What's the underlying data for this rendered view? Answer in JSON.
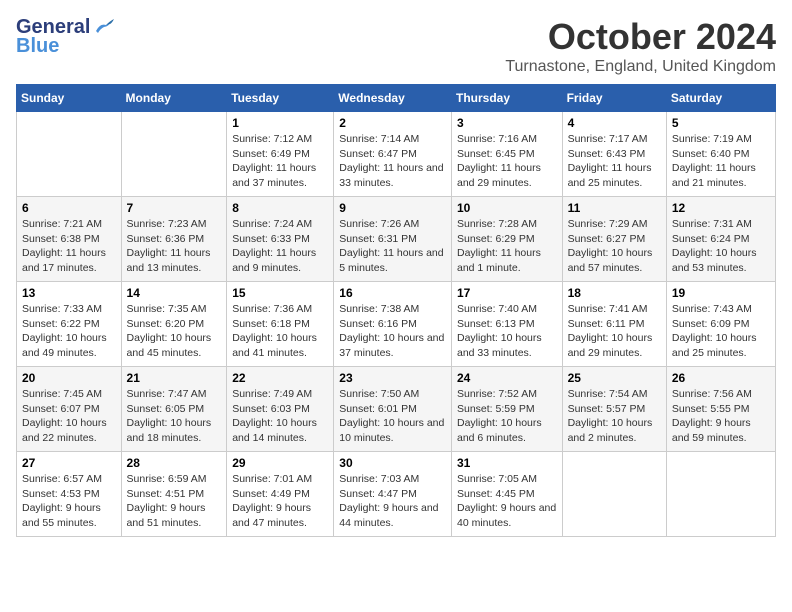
{
  "header": {
    "logo_line1": "General",
    "logo_line2": "Blue",
    "month_title": "October 2024",
    "subtitle": "Turnastone, England, United Kingdom"
  },
  "weekdays": [
    "Sunday",
    "Monday",
    "Tuesday",
    "Wednesday",
    "Thursday",
    "Friday",
    "Saturday"
  ],
  "weeks": [
    [
      {
        "day": "",
        "sunrise": "",
        "sunset": "",
        "daylight": ""
      },
      {
        "day": "",
        "sunrise": "",
        "sunset": "",
        "daylight": ""
      },
      {
        "day": "1",
        "sunrise": "Sunrise: 7:12 AM",
        "sunset": "Sunset: 6:49 PM",
        "daylight": "Daylight: 11 hours and 37 minutes."
      },
      {
        "day": "2",
        "sunrise": "Sunrise: 7:14 AM",
        "sunset": "Sunset: 6:47 PM",
        "daylight": "Daylight: 11 hours and 33 minutes."
      },
      {
        "day": "3",
        "sunrise": "Sunrise: 7:16 AM",
        "sunset": "Sunset: 6:45 PM",
        "daylight": "Daylight: 11 hours and 29 minutes."
      },
      {
        "day": "4",
        "sunrise": "Sunrise: 7:17 AM",
        "sunset": "Sunset: 6:43 PM",
        "daylight": "Daylight: 11 hours and 25 minutes."
      },
      {
        "day": "5",
        "sunrise": "Sunrise: 7:19 AM",
        "sunset": "Sunset: 6:40 PM",
        "daylight": "Daylight: 11 hours and 21 minutes."
      }
    ],
    [
      {
        "day": "6",
        "sunrise": "Sunrise: 7:21 AM",
        "sunset": "Sunset: 6:38 PM",
        "daylight": "Daylight: 11 hours and 17 minutes."
      },
      {
        "day": "7",
        "sunrise": "Sunrise: 7:23 AM",
        "sunset": "Sunset: 6:36 PM",
        "daylight": "Daylight: 11 hours and 13 minutes."
      },
      {
        "day": "8",
        "sunrise": "Sunrise: 7:24 AM",
        "sunset": "Sunset: 6:33 PM",
        "daylight": "Daylight: 11 hours and 9 minutes."
      },
      {
        "day": "9",
        "sunrise": "Sunrise: 7:26 AM",
        "sunset": "Sunset: 6:31 PM",
        "daylight": "Daylight: 11 hours and 5 minutes."
      },
      {
        "day": "10",
        "sunrise": "Sunrise: 7:28 AM",
        "sunset": "Sunset: 6:29 PM",
        "daylight": "Daylight: 11 hours and 1 minute."
      },
      {
        "day": "11",
        "sunrise": "Sunrise: 7:29 AM",
        "sunset": "Sunset: 6:27 PM",
        "daylight": "Daylight: 10 hours and 57 minutes."
      },
      {
        "day": "12",
        "sunrise": "Sunrise: 7:31 AM",
        "sunset": "Sunset: 6:24 PM",
        "daylight": "Daylight: 10 hours and 53 minutes."
      }
    ],
    [
      {
        "day": "13",
        "sunrise": "Sunrise: 7:33 AM",
        "sunset": "Sunset: 6:22 PM",
        "daylight": "Daylight: 10 hours and 49 minutes."
      },
      {
        "day": "14",
        "sunrise": "Sunrise: 7:35 AM",
        "sunset": "Sunset: 6:20 PM",
        "daylight": "Daylight: 10 hours and 45 minutes."
      },
      {
        "day": "15",
        "sunrise": "Sunrise: 7:36 AM",
        "sunset": "Sunset: 6:18 PM",
        "daylight": "Daylight: 10 hours and 41 minutes."
      },
      {
        "day": "16",
        "sunrise": "Sunrise: 7:38 AM",
        "sunset": "Sunset: 6:16 PM",
        "daylight": "Daylight: 10 hours and 37 minutes."
      },
      {
        "day": "17",
        "sunrise": "Sunrise: 7:40 AM",
        "sunset": "Sunset: 6:13 PM",
        "daylight": "Daylight: 10 hours and 33 minutes."
      },
      {
        "day": "18",
        "sunrise": "Sunrise: 7:41 AM",
        "sunset": "Sunset: 6:11 PM",
        "daylight": "Daylight: 10 hours and 29 minutes."
      },
      {
        "day": "19",
        "sunrise": "Sunrise: 7:43 AM",
        "sunset": "Sunset: 6:09 PM",
        "daylight": "Daylight: 10 hours and 25 minutes."
      }
    ],
    [
      {
        "day": "20",
        "sunrise": "Sunrise: 7:45 AM",
        "sunset": "Sunset: 6:07 PM",
        "daylight": "Daylight: 10 hours and 22 minutes."
      },
      {
        "day": "21",
        "sunrise": "Sunrise: 7:47 AM",
        "sunset": "Sunset: 6:05 PM",
        "daylight": "Daylight: 10 hours and 18 minutes."
      },
      {
        "day": "22",
        "sunrise": "Sunrise: 7:49 AM",
        "sunset": "Sunset: 6:03 PM",
        "daylight": "Daylight: 10 hours and 14 minutes."
      },
      {
        "day": "23",
        "sunrise": "Sunrise: 7:50 AM",
        "sunset": "Sunset: 6:01 PM",
        "daylight": "Daylight: 10 hours and 10 minutes."
      },
      {
        "day": "24",
        "sunrise": "Sunrise: 7:52 AM",
        "sunset": "Sunset: 5:59 PM",
        "daylight": "Daylight: 10 hours and 6 minutes."
      },
      {
        "day": "25",
        "sunrise": "Sunrise: 7:54 AM",
        "sunset": "Sunset: 5:57 PM",
        "daylight": "Daylight: 10 hours and 2 minutes."
      },
      {
        "day": "26",
        "sunrise": "Sunrise: 7:56 AM",
        "sunset": "Sunset: 5:55 PM",
        "daylight": "Daylight: 9 hours and 59 minutes."
      }
    ],
    [
      {
        "day": "27",
        "sunrise": "Sunrise: 6:57 AM",
        "sunset": "Sunset: 4:53 PM",
        "daylight": "Daylight: 9 hours and 55 minutes."
      },
      {
        "day": "28",
        "sunrise": "Sunrise: 6:59 AM",
        "sunset": "Sunset: 4:51 PM",
        "daylight": "Daylight: 9 hours and 51 minutes."
      },
      {
        "day": "29",
        "sunrise": "Sunrise: 7:01 AM",
        "sunset": "Sunset: 4:49 PM",
        "daylight": "Daylight: 9 hours and 47 minutes."
      },
      {
        "day": "30",
        "sunrise": "Sunrise: 7:03 AM",
        "sunset": "Sunset: 4:47 PM",
        "daylight": "Daylight: 9 hours and 44 minutes."
      },
      {
        "day": "31",
        "sunrise": "Sunrise: 7:05 AM",
        "sunset": "Sunset: 4:45 PM",
        "daylight": "Daylight: 9 hours and 40 minutes."
      },
      {
        "day": "",
        "sunrise": "",
        "sunset": "",
        "daylight": ""
      },
      {
        "day": "",
        "sunrise": "",
        "sunset": "",
        "daylight": ""
      }
    ]
  ]
}
